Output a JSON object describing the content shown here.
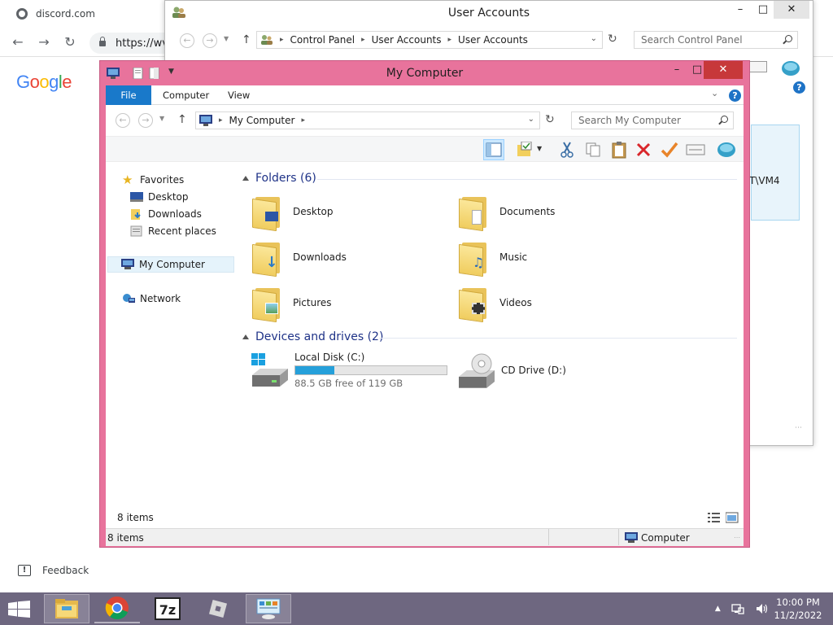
{
  "browser": {
    "tab_title": "discord.com",
    "url": "https://wv",
    "logo_text": "Google",
    "feedback_label": "Feedback"
  },
  "user_accounts": {
    "title": "User Accounts",
    "breadcrumb": [
      "Control Panel",
      "User Accounts",
      "User Accounts"
    ],
    "search_placeholder": "Search Control Panel",
    "panel_text": "T\\VM4"
  },
  "my_computer": {
    "title": "My Computer",
    "ribbon_tabs": [
      "File",
      "Computer",
      "View"
    ],
    "address": "My Computer",
    "search_placeholder": "Search My Computer",
    "sidebar": {
      "favorites": "Favorites",
      "desktop": "Desktop",
      "downloads": "Downloads",
      "recent": "Recent places",
      "computer": "My Computer",
      "network": "Network"
    },
    "folders_header": "Folders (6)",
    "folders": [
      "Desktop",
      "Documents",
      "Downloads",
      "Music",
      "Pictures",
      "Videos"
    ],
    "drives_header": "Devices and drives (2)",
    "drives": {
      "c_label": "Local Disk (C:)",
      "c_free": "88.5 GB free of 119 GB",
      "c_used_fraction": 0.256,
      "d_label": "CD Drive (D:)"
    },
    "pane_items": "8 items",
    "status_items": "8 items",
    "status_location": "Computer"
  },
  "clock": {
    "time": "10:00 PM",
    "date": "11/2/2022"
  },
  "colors": {
    "window_frame": "#e8739c",
    "file_tab": "#1979ca",
    "close_button": "#c7383a",
    "taskbar": "#6e6780",
    "group_header": "#1e3287",
    "drive_fill": "#26a0da"
  }
}
